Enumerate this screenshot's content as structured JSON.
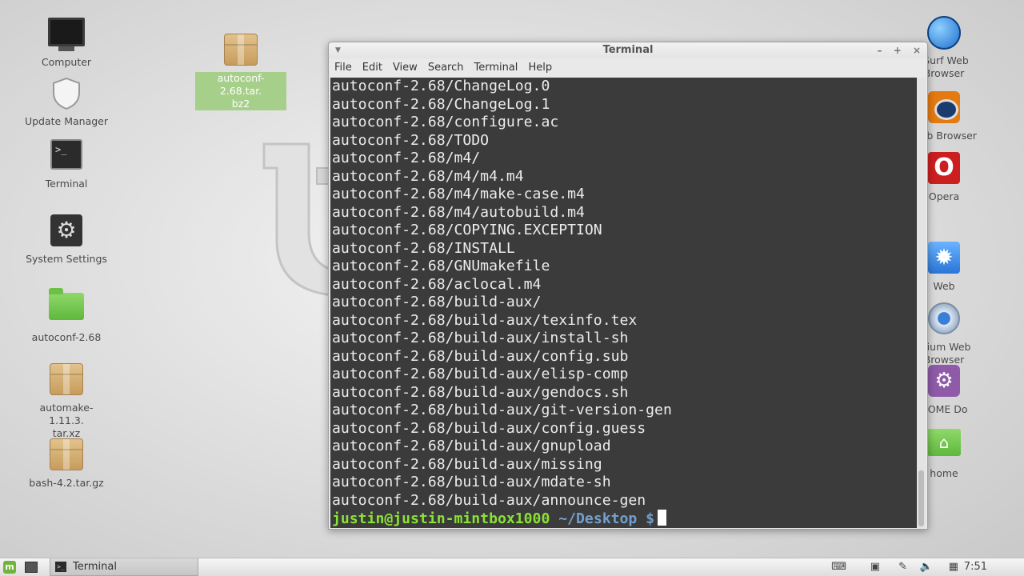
{
  "desktop": {
    "left_icons": [
      {
        "label": "Computer",
        "icon": "computer-icon"
      },
      {
        "label": "Update Manager",
        "icon": "shield-icon"
      },
      {
        "label": "Terminal",
        "icon": "terminal-icon"
      },
      {
        "label": "System Settings",
        "icon": "settings-icon"
      },
      {
        "label": "autoconf-2.68",
        "icon": "folder-icon"
      },
      {
        "label": "automake-1.11.3.\ntar.xz",
        "icon": "package-icon"
      },
      {
        "label": "bash-4.2.tar.gz",
        "icon": "package-icon"
      }
    ],
    "selected_icon": {
      "label": "autoconf-2.68.tar.\nbz2",
      "icon": "package-icon"
    },
    "right_icons": [
      {
        "label": "tSurf Web\nBrowser",
        "icon": "globe-icon"
      },
      {
        "label": "Web Browser",
        "icon": "eye-icon"
      },
      {
        "label": "Opera",
        "icon": "opera-icon",
        "glyph": "O"
      },
      {
        "label": "Web",
        "icon": "web-icon"
      },
      {
        "label": "mium Web\nBrowser",
        "icon": "chromium-icon"
      },
      {
        "label": "NOME Do",
        "icon": "gnome-do-icon"
      },
      {
        "label": "home",
        "icon": "home-folder-icon"
      }
    ]
  },
  "terminal": {
    "title": "Terminal",
    "menu": [
      "File",
      "Edit",
      "View",
      "Search",
      "Terminal",
      "Help"
    ],
    "lines": [
      "autoconf-2.68/ChangeLog.0",
      "autoconf-2.68/ChangeLog.1",
      "autoconf-2.68/configure.ac",
      "autoconf-2.68/TODO",
      "autoconf-2.68/m4/",
      "autoconf-2.68/m4/m4.m4",
      "autoconf-2.68/m4/make-case.m4",
      "autoconf-2.68/m4/autobuild.m4",
      "autoconf-2.68/COPYING.EXCEPTION",
      "autoconf-2.68/INSTALL",
      "autoconf-2.68/GNUmakefile",
      "autoconf-2.68/aclocal.m4",
      "autoconf-2.68/build-aux/",
      "autoconf-2.68/build-aux/texinfo.tex",
      "autoconf-2.68/build-aux/install-sh",
      "autoconf-2.68/build-aux/config.sub",
      "autoconf-2.68/build-aux/elisp-comp",
      "autoconf-2.68/build-aux/gendocs.sh",
      "autoconf-2.68/build-aux/git-version-gen",
      "autoconf-2.68/build-aux/config.guess",
      "autoconf-2.68/build-aux/gnupload",
      "autoconf-2.68/build-aux/missing",
      "autoconf-2.68/build-aux/mdate-sh",
      "autoconf-2.68/build-aux/announce-gen"
    ],
    "prompt_user": "justin@justin-mintbox1000",
    "prompt_path": "~/Desktop $",
    "colors": {
      "background": "#3b3b3b",
      "text": "#ececec",
      "prompt_user": "#8ae234",
      "prompt_path": "#729fcf"
    }
  },
  "panel": {
    "task_label": "Terminal",
    "clock": "7:51 PM"
  }
}
